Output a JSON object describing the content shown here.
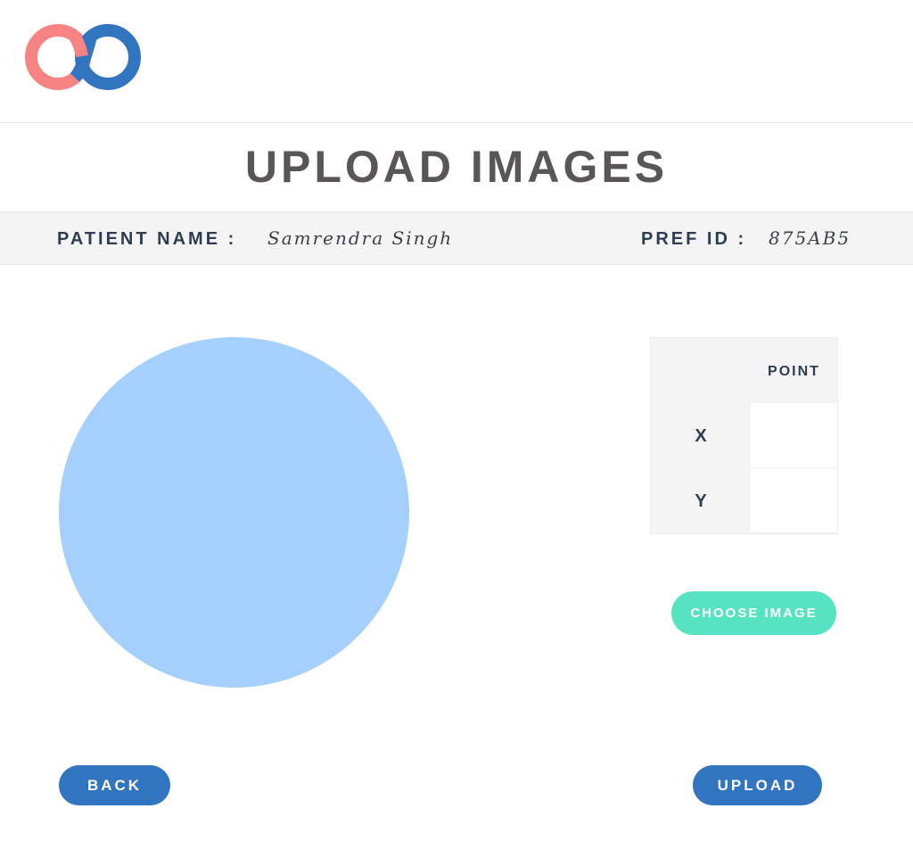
{
  "app": {
    "logo_icon": "infinity-logo-icon",
    "colors": {
      "logo_left": "#f78383",
      "logo_right": "#3174c0",
      "title_text": "#5a5556",
      "preview_circle": "#a5cffd",
      "primary_button": "#3174c0",
      "choose_button": "#55e3c1"
    }
  },
  "page": {
    "title": "UPLOAD IMAGES"
  },
  "patient": {
    "name_label": "PATIENT NAME :",
    "name_value": "Samrendra Singh",
    "pref_label": "PREF ID :",
    "pref_value": "875AB5"
  },
  "point_table": {
    "header": "POINT",
    "rows": [
      {
        "label": "X",
        "value": ""
      },
      {
        "label": "Y",
        "value": ""
      }
    ]
  },
  "actions": {
    "choose_image": "CHOOSE IMAGE",
    "back": "BACK",
    "upload": "UPLOAD"
  }
}
